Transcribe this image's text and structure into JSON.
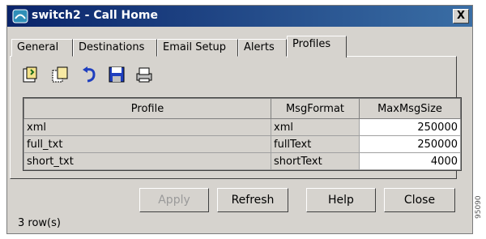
{
  "window": {
    "title": "switch2 - Call Home",
    "close_label": "X"
  },
  "tabs": [
    {
      "label": "General",
      "active": false
    },
    {
      "label": "Destinations",
      "active": false
    },
    {
      "label": "Email Setup",
      "active": false
    },
    {
      "label": "Alerts",
      "active": false
    },
    {
      "label": "Profiles",
      "active": true
    }
  ],
  "toolbar": {
    "buttons": [
      "create-row-icon",
      "copy-row-icon",
      "refresh-undo-icon",
      "save-icon",
      "print-icon"
    ]
  },
  "table": {
    "columns": [
      "Profile",
      "MsgFormat",
      "MaxMsgSize"
    ],
    "rows": [
      [
        "xml",
        "xml",
        "250000"
      ],
      [
        "full_txt",
        "fullText",
        "250000"
      ],
      [
        "short_txt",
        "shortText",
        "4000"
      ]
    ]
  },
  "buttons": {
    "apply": "Apply",
    "refresh": "Refresh",
    "help": "Help",
    "close": "Close"
  },
  "status": {
    "row_count": "3 row(s)"
  },
  "side_label": "95090",
  "colors": {
    "title_bar": "#0a246a",
    "dialog_bg": "#d6d3ce"
  }
}
